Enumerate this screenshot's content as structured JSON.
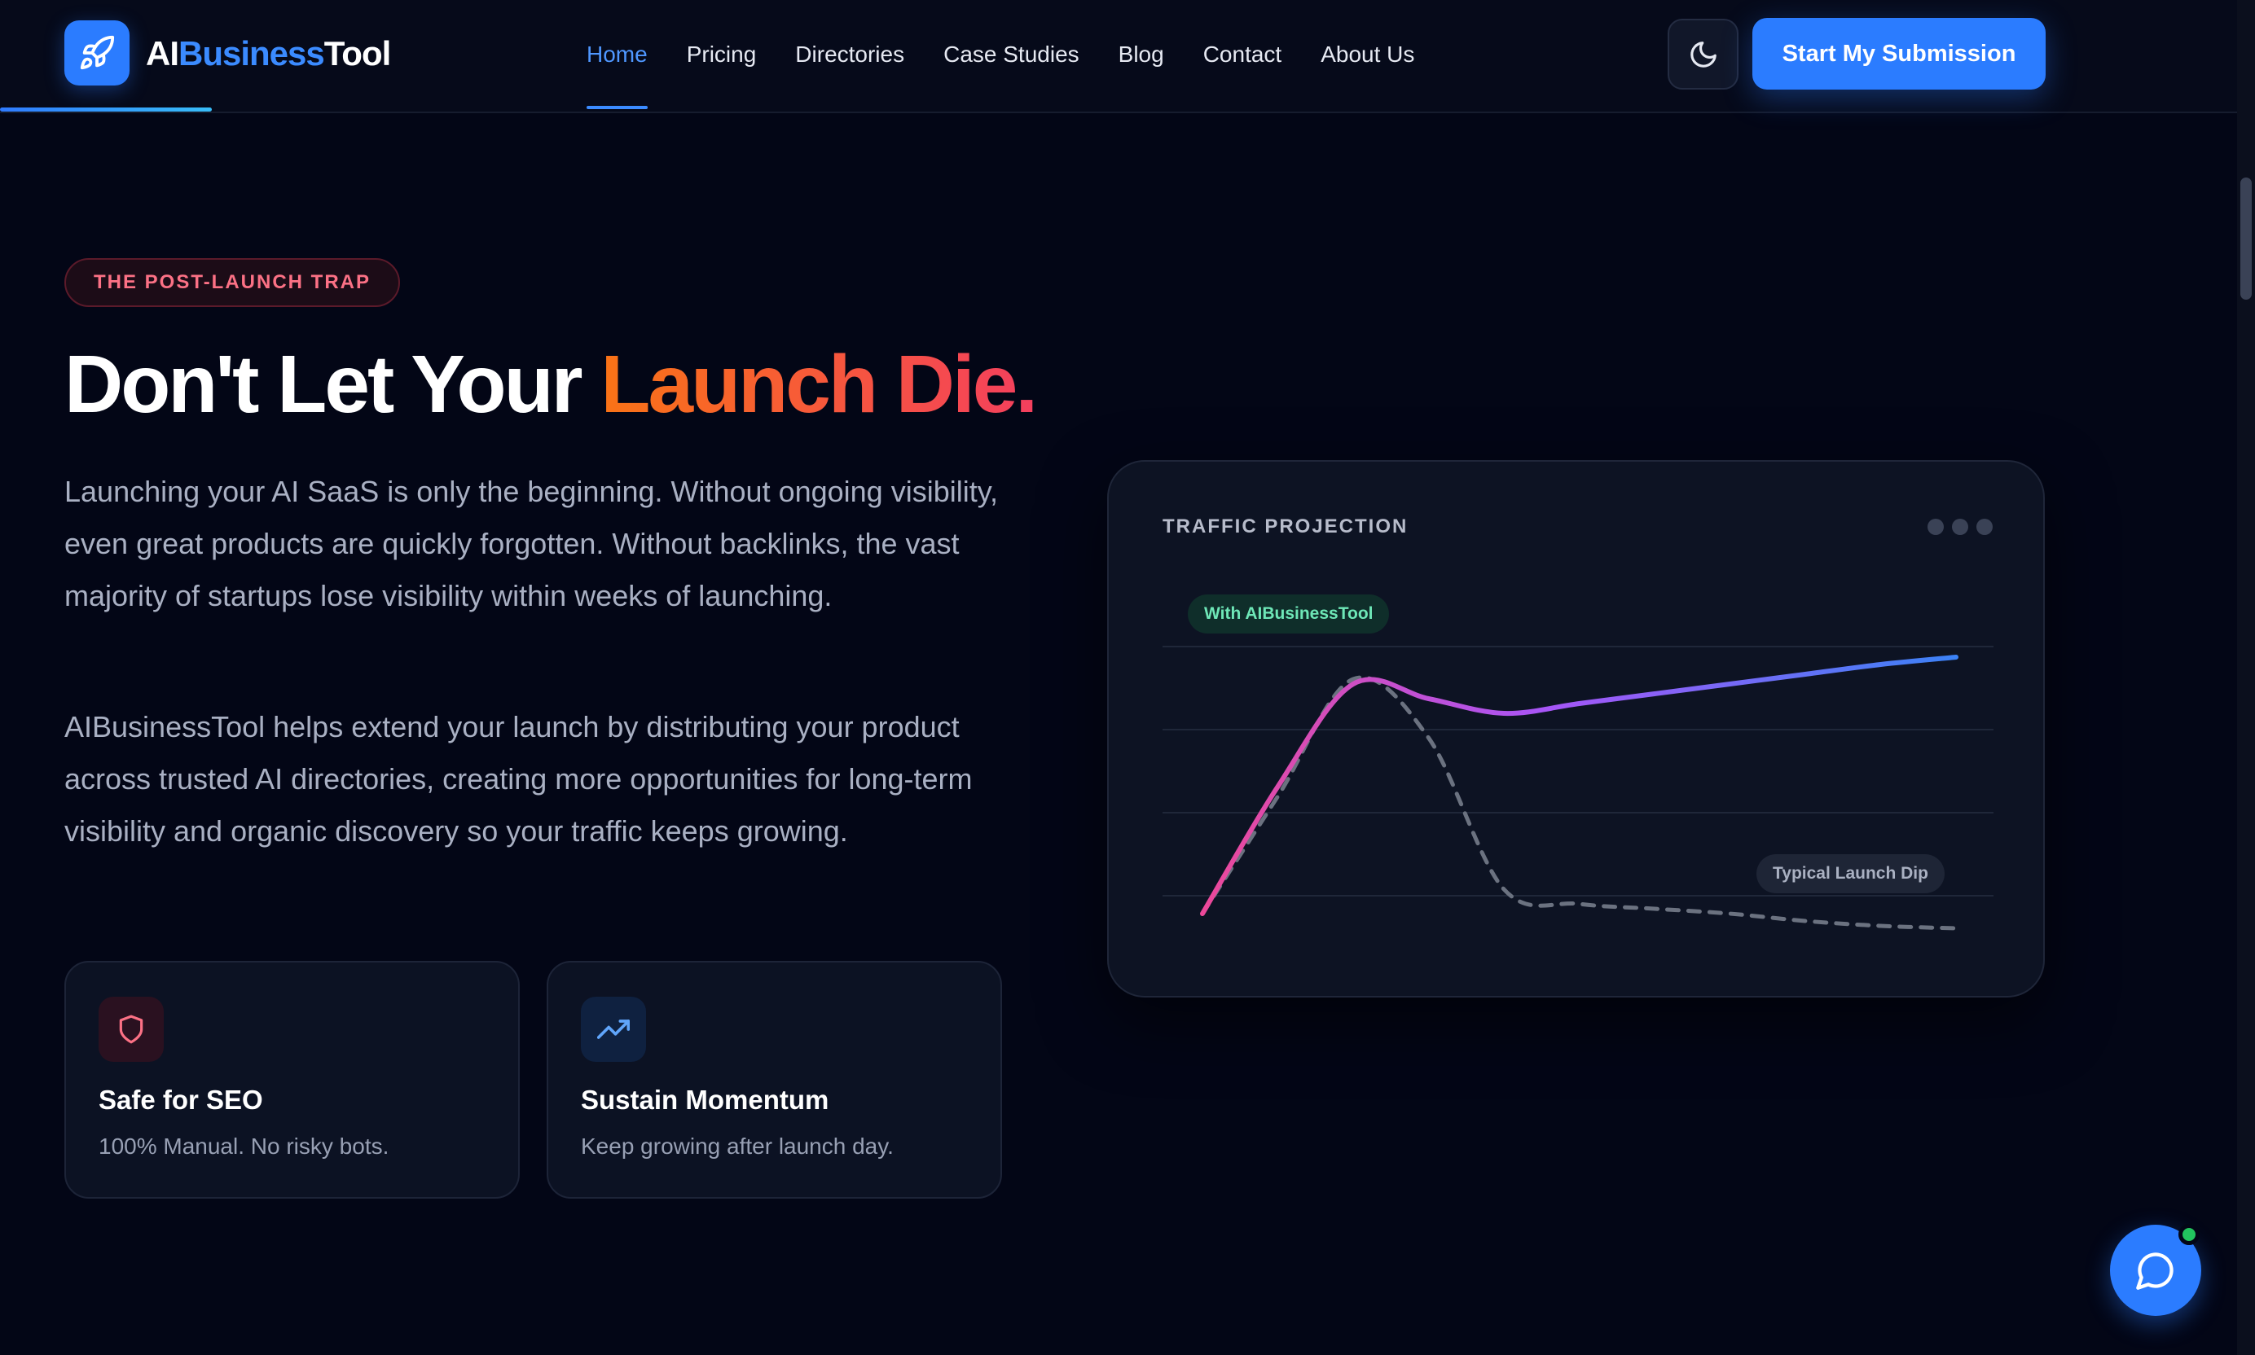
{
  "header": {
    "brand": {
      "part1": "AI",
      "part2": "Business",
      "part3": "Tool"
    },
    "nav": [
      {
        "label": "Home",
        "active": true
      },
      {
        "label": "Pricing"
      },
      {
        "label": "Directories"
      },
      {
        "label": "Case Studies"
      },
      {
        "label": "Blog"
      },
      {
        "label": "Contact"
      },
      {
        "label": "About Us"
      }
    ],
    "theme_toggle_icon": "moon-icon",
    "cta_label": "Start My Submission"
  },
  "hero": {
    "badge": "THE POST-LAUNCH TRAP",
    "title_plain": "Don't Let Your ",
    "title_highlight": "Launch Die.",
    "paragraph1": "Launching your AI SaaS is only the beginning. Without ongoing visibility, even great products are quickly forgotten. Without backlinks, the vast majority of startups lose visibility within weeks of launching.",
    "paragraph2": "AIBusinessTool helps extend your launch by distributing your product across trusted AI directories, creating more opportunities for long-term visibility and organic discovery so your traffic keeps growing.",
    "features": [
      {
        "icon": "shield-icon",
        "title": "Safe for SEO",
        "desc": "100% Manual. No risky bots."
      },
      {
        "icon": "trending-up-icon",
        "title": "Sustain Momentum",
        "desc": "Keep growing after launch day."
      }
    ]
  },
  "chart_data": {
    "type": "line",
    "title": "TRAFFIC PROJECTION",
    "xlabel": "",
    "ylabel": "",
    "grid": true,
    "x": [
      0,
      1,
      2,
      3,
      4,
      5,
      6,
      7,
      8,
      9,
      10
    ],
    "ylim": [
      0,
      100
    ],
    "series": [
      {
        "name": "With AIBusinessTool",
        "style": "solid",
        "colors": [
          "#ec4899",
          "#a855f7",
          "#3b82f6"
        ],
        "values": [
          0,
          52,
          94,
          88,
          82,
          86,
          90,
          94,
          98,
          102,
          105
        ]
      },
      {
        "name": "Typical Launch Dip",
        "style": "dashed",
        "color": "#6b7280",
        "values": [
          0,
          48,
          96,
          72,
          10,
          4,
          2,
          0,
          -3,
          -5,
          -6
        ]
      }
    ]
  },
  "colors": {
    "background": "#030616",
    "accent": "#2b7cff",
    "highlight_start": "#f97316",
    "highlight_end": "#f43f5e"
  },
  "chat": {
    "icon": "chat-bubble-icon",
    "status": "online"
  }
}
